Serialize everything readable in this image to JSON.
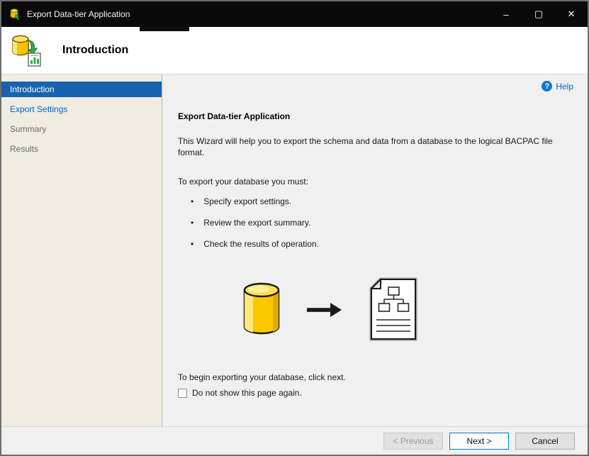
{
  "window": {
    "title": "Export Data-tier Application",
    "controls": {
      "minimize": "–",
      "maximize": "▢",
      "close": "✕"
    }
  },
  "header": {
    "title": "Introduction"
  },
  "sidebar": {
    "items": [
      {
        "label": "Introduction",
        "state": "active"
      },
      {
        "label": "Export Settings",
        "state": "link"
      },
      {
        "label": "Summary",
        "state": "disabled"
      },
      {
        "label": "Results",
        "state": "disabled"
      }
    ]
  },
  "content": {
    "help_label": "Help",
    "help_icon_glyph": "?",
    "heading": "Export Data-tier Application",
    "intro": "This Wizard will help you to export the schema and data from a database to the logical BACPAC file format.",
    "must_label": "To export your database you must:",
    "bullets": [
      "Specify export settings.",
      "Review the export summary.",
      "Check the results of operation."
    ],
    "begin_text": "To begin exporting your database, click next.",
    "checkbox_label": "Do not show this page again.",
    "checkbox_checked": false
  },
  "footer": {
    "previous_label": "< Previous",
    "next_label": "Next >",
    "cancel_label": "Cancel"
  },
  "colors": {
    "titlebar_bg": "#0a0a0a",
    "active_nav_blue": "#1863ad",
    "link_blue": "#0066cc",
    "sidebar_bg": "#f0ece1",
    "content_bg": "#f0f0f0",
    "next_button_border": "#0078d7"
  }
}
